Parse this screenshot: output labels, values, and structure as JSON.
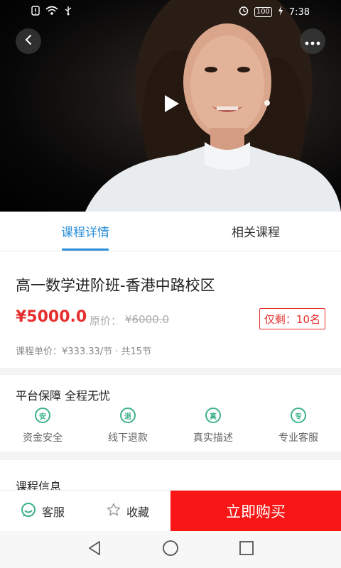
{
  "status_bar": {
    "time": "7:38",
    "battery": "100",
    "icons": [
      "alert-icon",
      "wifi-icon",
      "usb-icon",
      "alarm-icon",
      "charging-icon"
    ]
  },
  "video": {
    "controls": [
      "back-icon",
      "more-icon",
      "play-icon"
    ]
  },
  "tabs": [
    {
      "label": "课程详情",
      "active": true
    },
    {
      "label": "相关课程",
      "active": false
    }
  ],
  "course": {
    "title": "高一数学进阶班-香港中路校区",
    "price": "¥5000.0",
    "original_label": "原价：",
    "original_price": "¥6000.0",
    "remaining": "仅剩：10名",
    "unit_price": "课程单价：¥333.33/节 · 共15节"
  },
  "guarantee": {
    "title": "平台保障 全程无忧",
    "items": [
      {
        "badge": "安",
        "label": "资金安全"
      },
      {
        "badge": "退",
        "label": "线下退款"
      },
      {
        "badge": "真",
        "label": "真实描述"
      },
      {
        "badge": "专",
        "label": "专业客服"
      }
    ]
  },
  "info": {
    "title": "课程信息"
  },
  "action_bar": {
    "service_label": "客服",
    "favorite_label": "收藏",
    "buy_label": "立即购买"
  },
  "colors": {
    "accent": "#2b8fd8",
    "price_red": "#e62e2e",
    "buy_red": "#f81616",
    "guarantee_green": "#3db28a"
  }
}
